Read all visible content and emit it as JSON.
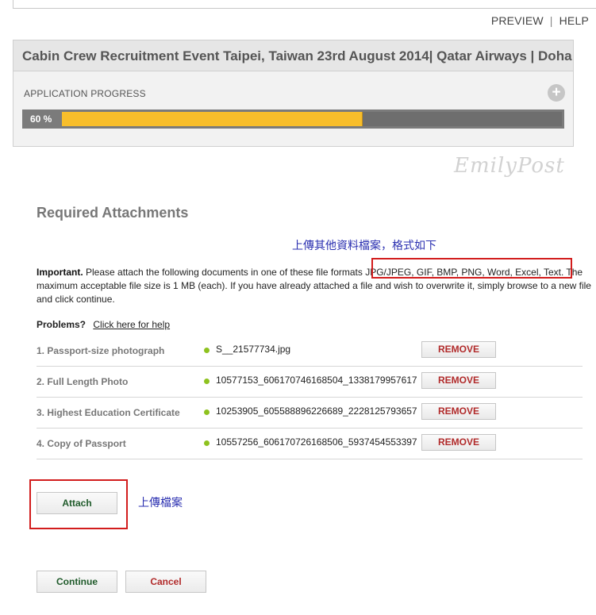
{
  "top_links": {
    "preview": "PREVIEW",
    "separator": "|",
    "help": "HELP"
  },
  "event": {
    "title": "Cabin Crew Recruitment Event Taipei, Taiwan 23rd August 2014| Qatar Airways | Doha",
    "progress_label": "APPLICATION PROGRESS",
    "progress_value": 60,
    "progress_text": "60 %",
    "expand_icon": "plus-icon"
  },
  "watermark": "EmilyPost",
  "attachments_section": {
    "title": "Required Attachments",
    "note_zh_formats": "上傳其他資料檔案，格式如下",
    "important_label": "Important.",
    "important_text_before": " Please attach the following documents in one of these file formats ",
    "formats": "JPG/JPEG, GIF, BMP, PNG, Word, Excel, Text.",
    "important_text_after": " The maximum acceptable file size is 1 MB (each). If you have already attached a file and wish to overwrite it, simply browse to a new file and click continue.",
    "problems_label": "Problems?",
    "help_link": "Click here for help",
    "remove_label": "REMOVE",
    "items": [
      {
        "label": "1. Passport-size photograph",
        "file": "S__21577734.jpg"
      },
      {
        "label": "2. Full Length Photo",
        "file": "10577153_606170746168504_1338179957617"
      },
      {
        "label": "3. Highest Education Certificate",
        "file": "10253905_605588896226689_2228125793657"
      },
      {
        "label": "4. Copy of Passport",
        "file": "10557256_606170726168506_5937454553397"
      }
    ]
  },
  "actions": {
    "attach": "Attach",
    "note_zh_upload": "上傳檔案",
    "continue": "Continue",
    "cancel": "Cancel"
  },
  "colors": {
    "progress_fill": "#f8be2b",
    "status_dot": "#8ec21f",
    "highlight_box": "#d21d1d",
    "annotation_text": "#2a2fb0"
  }
}
